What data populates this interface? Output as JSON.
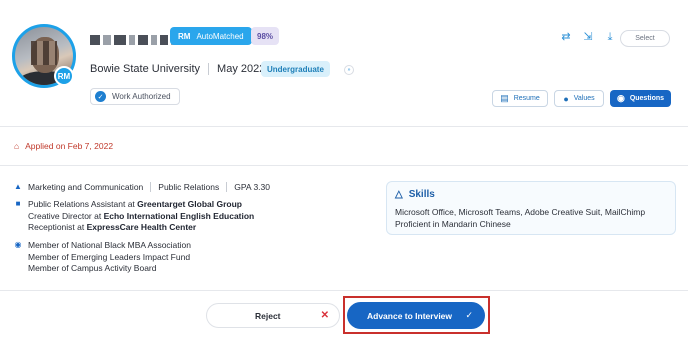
{
  "candidate": {
    "avatar_badge": "RM",
    "match_label": "AutoMatched",
    "match_icon": "RM",
    "match_score": "98%",
    "school": "Bowie State University",
    "grad_date": "May 2022",
    "level": "Undergraduate",
    "work_auth": "Work Authorized",
    "applied": "Applied on Feb 7, 2022"
  },
  "header_actions": {
    "select_label": "Select",
    "icons": [
      "shuffle-icon",
      "compare-icon",
      "download-icon"
    ]
  },
  "tabs": {
    "resume": "Resume",
    "values": "Values",
    "questions": "Questions"
  },
  "education": {
    "major": "Marketing and Communication",
    "minor": "Public Relations",
    "gpa": "GPA 3.30"
  },
  "experience": [
    {
      "role": "Public Relations Assistant at ",
      "org": "Greentarget Global Group"
    },
    {
      "role": "Creative Director at ",
      "org": "Echo International English Education"
    },
    {
      "role": "Receptionist at ",
      "org": "ExpressCare Health Center"
    }
  ],
  "memberships": [
    "Member of National Black MBA Association",
    "Member of Emerging Leaders Impact Fund",
    "Member of Campus Activity Board"
  ],
  "skills": {
    "title": "Skills",
    "line1": "Microsoft Office, Microsoft Teams, Adobe Creative Suit, MailChimp",
    "line2": "Proficient in Mandarin Chinese"
  },
  "footer": {
    "reject": "Reject",
    "advance": "Advance to Interview"
  },
  "colors": {
    "primary": "#1766c4",
    "accent": "#2aa6ec",
    "danger": "#d9303a",
    "applied": "#c0392b",
    "highlight_frame": "#c9302c"
  }
}
